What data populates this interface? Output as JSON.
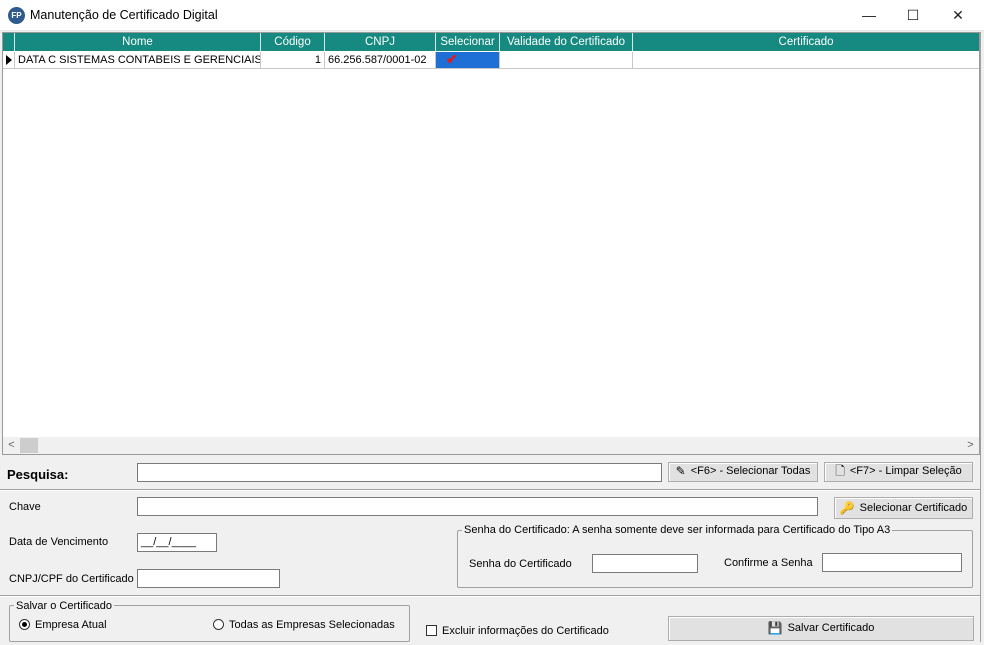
{
  "window": {
    "title": "Manutenção de Certificado Digital",
    "icon_text": "FP",
    "minimize": "—",
    "maximize": "☐",
    "close": "✕"
  },
  "grid": {
    "columns": [
      "Nome",
      "Código",
      "CNPJ",
      "Selecionar",
      "Validade do Certificado",
      "Certificado"
    ],
    "rows": [
      {
        "nome": "DATA C SISTEMAS CONTABEIS E GERENCIAIS",
        "codigo": "1",
        "cnpj": "66.256.587/0001-02",
        "selecionar_mark": "✔",
        "validade": "",
        "certificado": ""
      }
    ],
    "scroll_left": "<",
    "scroll_right": ">"
  },
  "search": {
    "label": "Pesquisa:",
    "value": "",
    "select_all_label": "<F6> - Selecionar Todas",
    "clear_label": "<F7> - Limpar Seleção"
  },
  "form": {
    "chave_label": "Chave",
    "chave_value": "",
    "select_cert_label": "Selecionar Certificado",
    "vencimento_label": "Data de Vencimento",
    "vencimento_value": "__/__/____",
    "cnpj_label": "CNPJ/CPF do Certificado",
    "cnpj_value": "",
    "senha_group_title": "Senha do Certificado: A senha somente deve ser informada para Certificado do Tipo A3",
    "senha_label": "Senha do Certificado",
    "senha_value": "",
    "confirma_label": "Confirme a Senha",
    "confirma_value": ""
  },
  "save": {
    "group_title": "Salvar o Certificado",
    "option_current": "Empresa Atual",
    "option_all": "Todas as Empresas Selecionadas",
    "delete_info_label": "Excluir informações do Certificado",
    "save_button_label": "Salvar Certificado"
  },
  "colors": {
    "grid_header": "#168a80",
    "selected_cell": "#1e6fd6",
    "check_mark": "#e21b1b"
  }
}
